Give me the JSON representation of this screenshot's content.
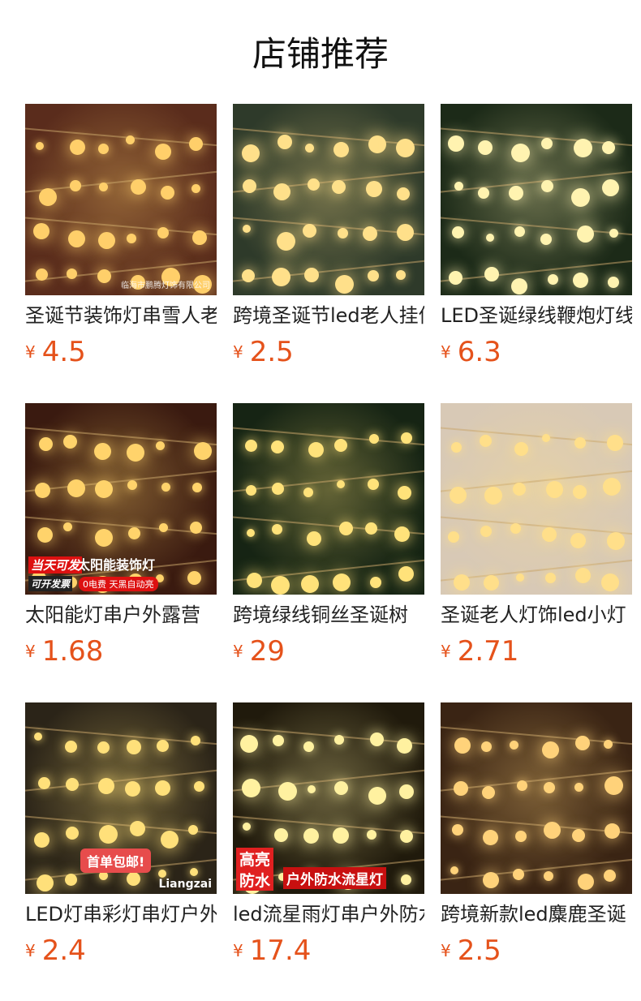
{
  "page": {
    "title": "店铺推荐"
  },
  "products": [
    {
      "name": "圣诞节装饰灯串雪人老人",
      "currency": "¥",
      "price": "4.5",
      "image": {
        "bg": "#5a2c1c",
        "glow": "#ffcf6a",
        "watermark": "临海市鹏腾灯饰有限公司"
      }
    },
    {
      "name": "跨境圣诞节led老人挂件",
      "currency": "¥",
      "price": "2.5",
      "image": {
        "bg": "#2e3a2a",
        "glow": "#ffe08a"
      }
    },
    {
      "name": "LED圣诞绿线鞭炮灯线",
      "currency": "¥",
      "price": "6.3",
      "image": {
        "bg": "#1c2a18",
        "glow": "#fff3b0"
      }
    },
    {
      "name": "太阳能灯串户外露营",
      "currency": "¥",
      "price": "1.68",
      "image": {
        "bg": "#3a1a10",
        "glow": "#ffd36b",
        "badge1": "当天可发",
        "badge2": "太阳能装饰灯",
        "badge3": "可开发票",
        "badge4": "0电费 天黑自动亮"
      }
    },
    {
      "name": "跨境绿线铜丝圣诞树",
      "currency": "¥",
      "price": "29",
      "image": {
        "bg": "#162414",
        "glow": "#ffe27a"
      }
    },
    {
      "name": "圣诞老人灯饰led小灯",
      "currency": "¥",
      "price": "2.71",
      "image": {
        "bg": "#d8c9b6",
        "glow": "#ffdf8a"
      }
    },
    {
      "name": "LED灯串彩灯串灯户外",
      "currency": "¥",
      "price": "2.4",
      "image": {
        "bg": "#2b2418",
        "glow": "#ffe07a",
        "badge1": "首单包邮!",
        "badge2": "Liangzai"
      }
    },
    {
      "name": "led流星雨灯串户外防水",
      "currency": "¥",
      "price": "17.4",
      "image": {
        "bg": "#201a0c",
        "glow": "#fff1a0",
        "badge1": "高亮",
        "badge2": "防水",
        "badge3": "户外防水流星灯"
      }
    },
    {
      "name": "跨境新款led麋鹿圣诞",
      "currency": "¥",
      "price": "2.5",
      "image": {
        "bg": "#3a2414",
        "glow": "#ffd27a"
      }
    }
  ]
}
